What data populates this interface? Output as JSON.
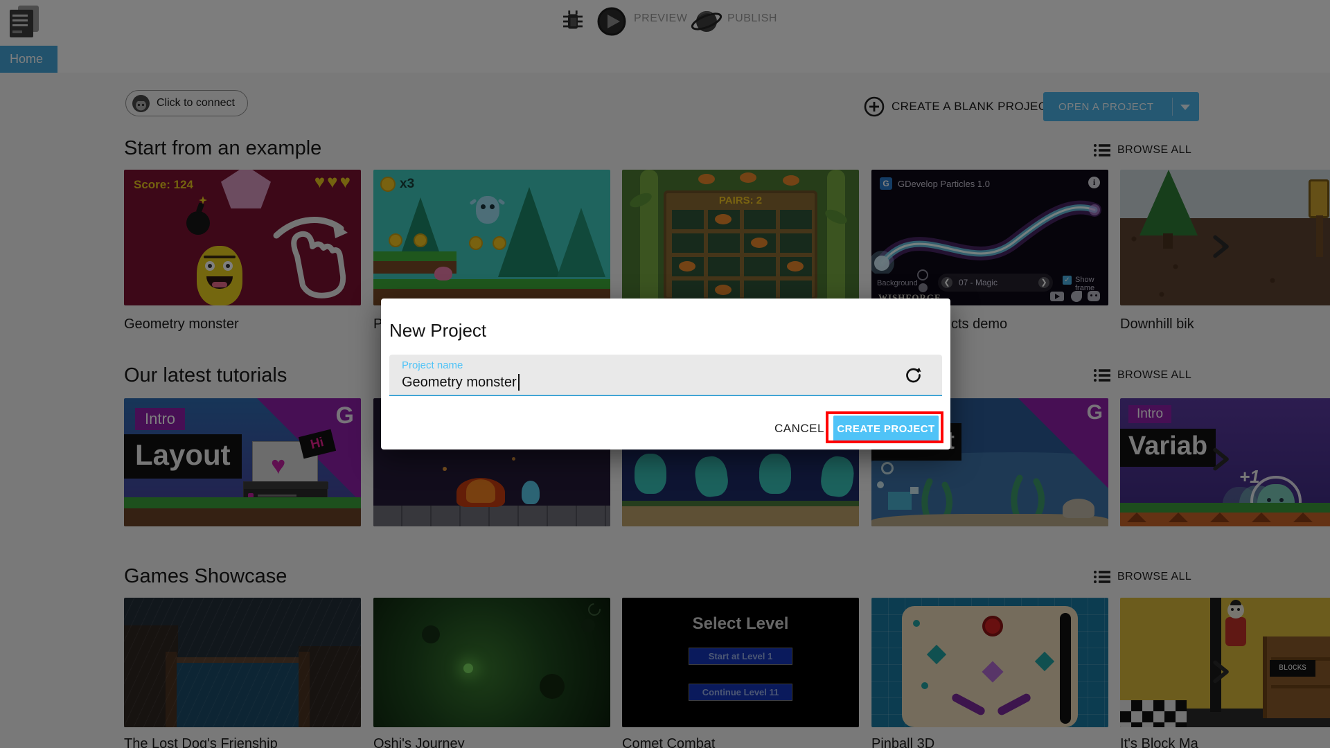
{
  "toolbar": {
    "home_tab": "Home",
    "preview": "PREVIEW",
    "publish": "PUBLISH"
  },
  "header": {
    "connect": "Click to connect",
    "create_blank": "CREATE A BLANK PROJECT",
    "open_project": "OPEN A PROJECT"
  },
  "sections": {
    "examples_title": "Start from an example",
    "tutorials_title": "Our latest tutorials",
    "showcase_title": "Games Showcase",
    "browse_all": "BROWSE ALL"
  },
  "cards": {
    "geometry": {
      "title": "Geometry monster",
      "score": "Score: 124",
      "hearts": "♥♥♥"
    },
    "platformer": {
      "title_fragment": "P",
      "coin_count": "x3"
    },
    "pairs": {
      "label": "PAIRS: 2"
    },
    "particles": {
      "title_fragment": "cts demo",
      "header": "GDevelop Particles 1.0",
      "background_label": "Background",
      "preset": "07 - Magic",
      "show_frame": "Show frame",
      "brand": "WISHFORGE",
      "info": "i"
    },
    "downhill": {
      "title": "Downhill bik"
    }
  },
  "tutorials": {
    "layout": {
      "intro": "Intro",
      "name": "Layout",
      "hi": "Hi"
    },
    "quickstart": {
      "name_fragment": "start"
    },
    "variables": {
      "intro": "Intro",
      "name": "Variab",
      "plus": "+1"
    },
    "g_logo": "G"
  },
  "showcase": {
    "lost_dog": {
      "title": "The Lost Dog's Frienship"
    },
    "oshi": {
      "title": "Oshi's Journey"
    },
    "comet": {
      "title": "Comet Combat",
      "heading": "Select Level",
      "button1": "Start at Level 1",
      "button2": "Continue Level 11"
    },
    "pinball": {
      "title": "Pinball 3D"
    },
    "blocks": {
      "title": "It's Block Ma",
      "sign": "BLOCKS"
    }
  },
  "modal": {
    "title": "New Project",
    "field_label": "Project name",
    "field_value": "Geometry monster",
    "cancel": "CANCEL",
    "create": "CREATE PROJECT"
  },
  "colors": {
    "accent_blue": "#4fc3f7",
    "button_blue": "#4ab0e4",
    "tab_blue": "#45a5d8",
    "annotation_red": "#ff0000"
  }
}
